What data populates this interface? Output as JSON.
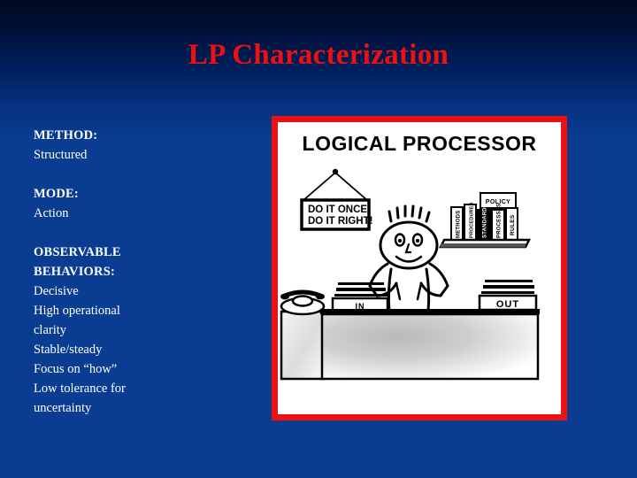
{
  "slide": {
    "title": "LP Characterization",
    "background_top_color": "#000820",
    "background_bottom_color": "#0a3d91",
    "title_color": "#ee1111"
  },
  "body": {
    "method_label": "METHOD:",
    "method_value": "Structured",
    "mode_label": "MODE:",
    "mode_value": "Action",
    "behaviors_label_line1": "OBSERVABLE",
    "behaviors_label_line2": "BEHAVIORS:",
    "behaviors": [
      "Decisive",
      "High operational",
      "clarity",
      "Stable/steady",
      "Focus on “how”",
      "Low tolerance for",
      "uncertainty"
    ]
  },
  "picture": {
    "border_color": "#ee1111",
    "background_color": "#ffffff",
    "heading": "LOGICAL PROCESSOR",
    "sign_line1": "DO IT ONCE,",
    "sign_line2": "DO IT RIGHT!",
    "in_tray_label": "IN",
    "out_tray_label": "OUT",
    "policy_box_label": "POLICY",
    "binders": [
      "METHODS",
      "PROCEDURES",
      "STANDARDS",
      "PROCESSES",
      "RULES"
    ]
  }
}
